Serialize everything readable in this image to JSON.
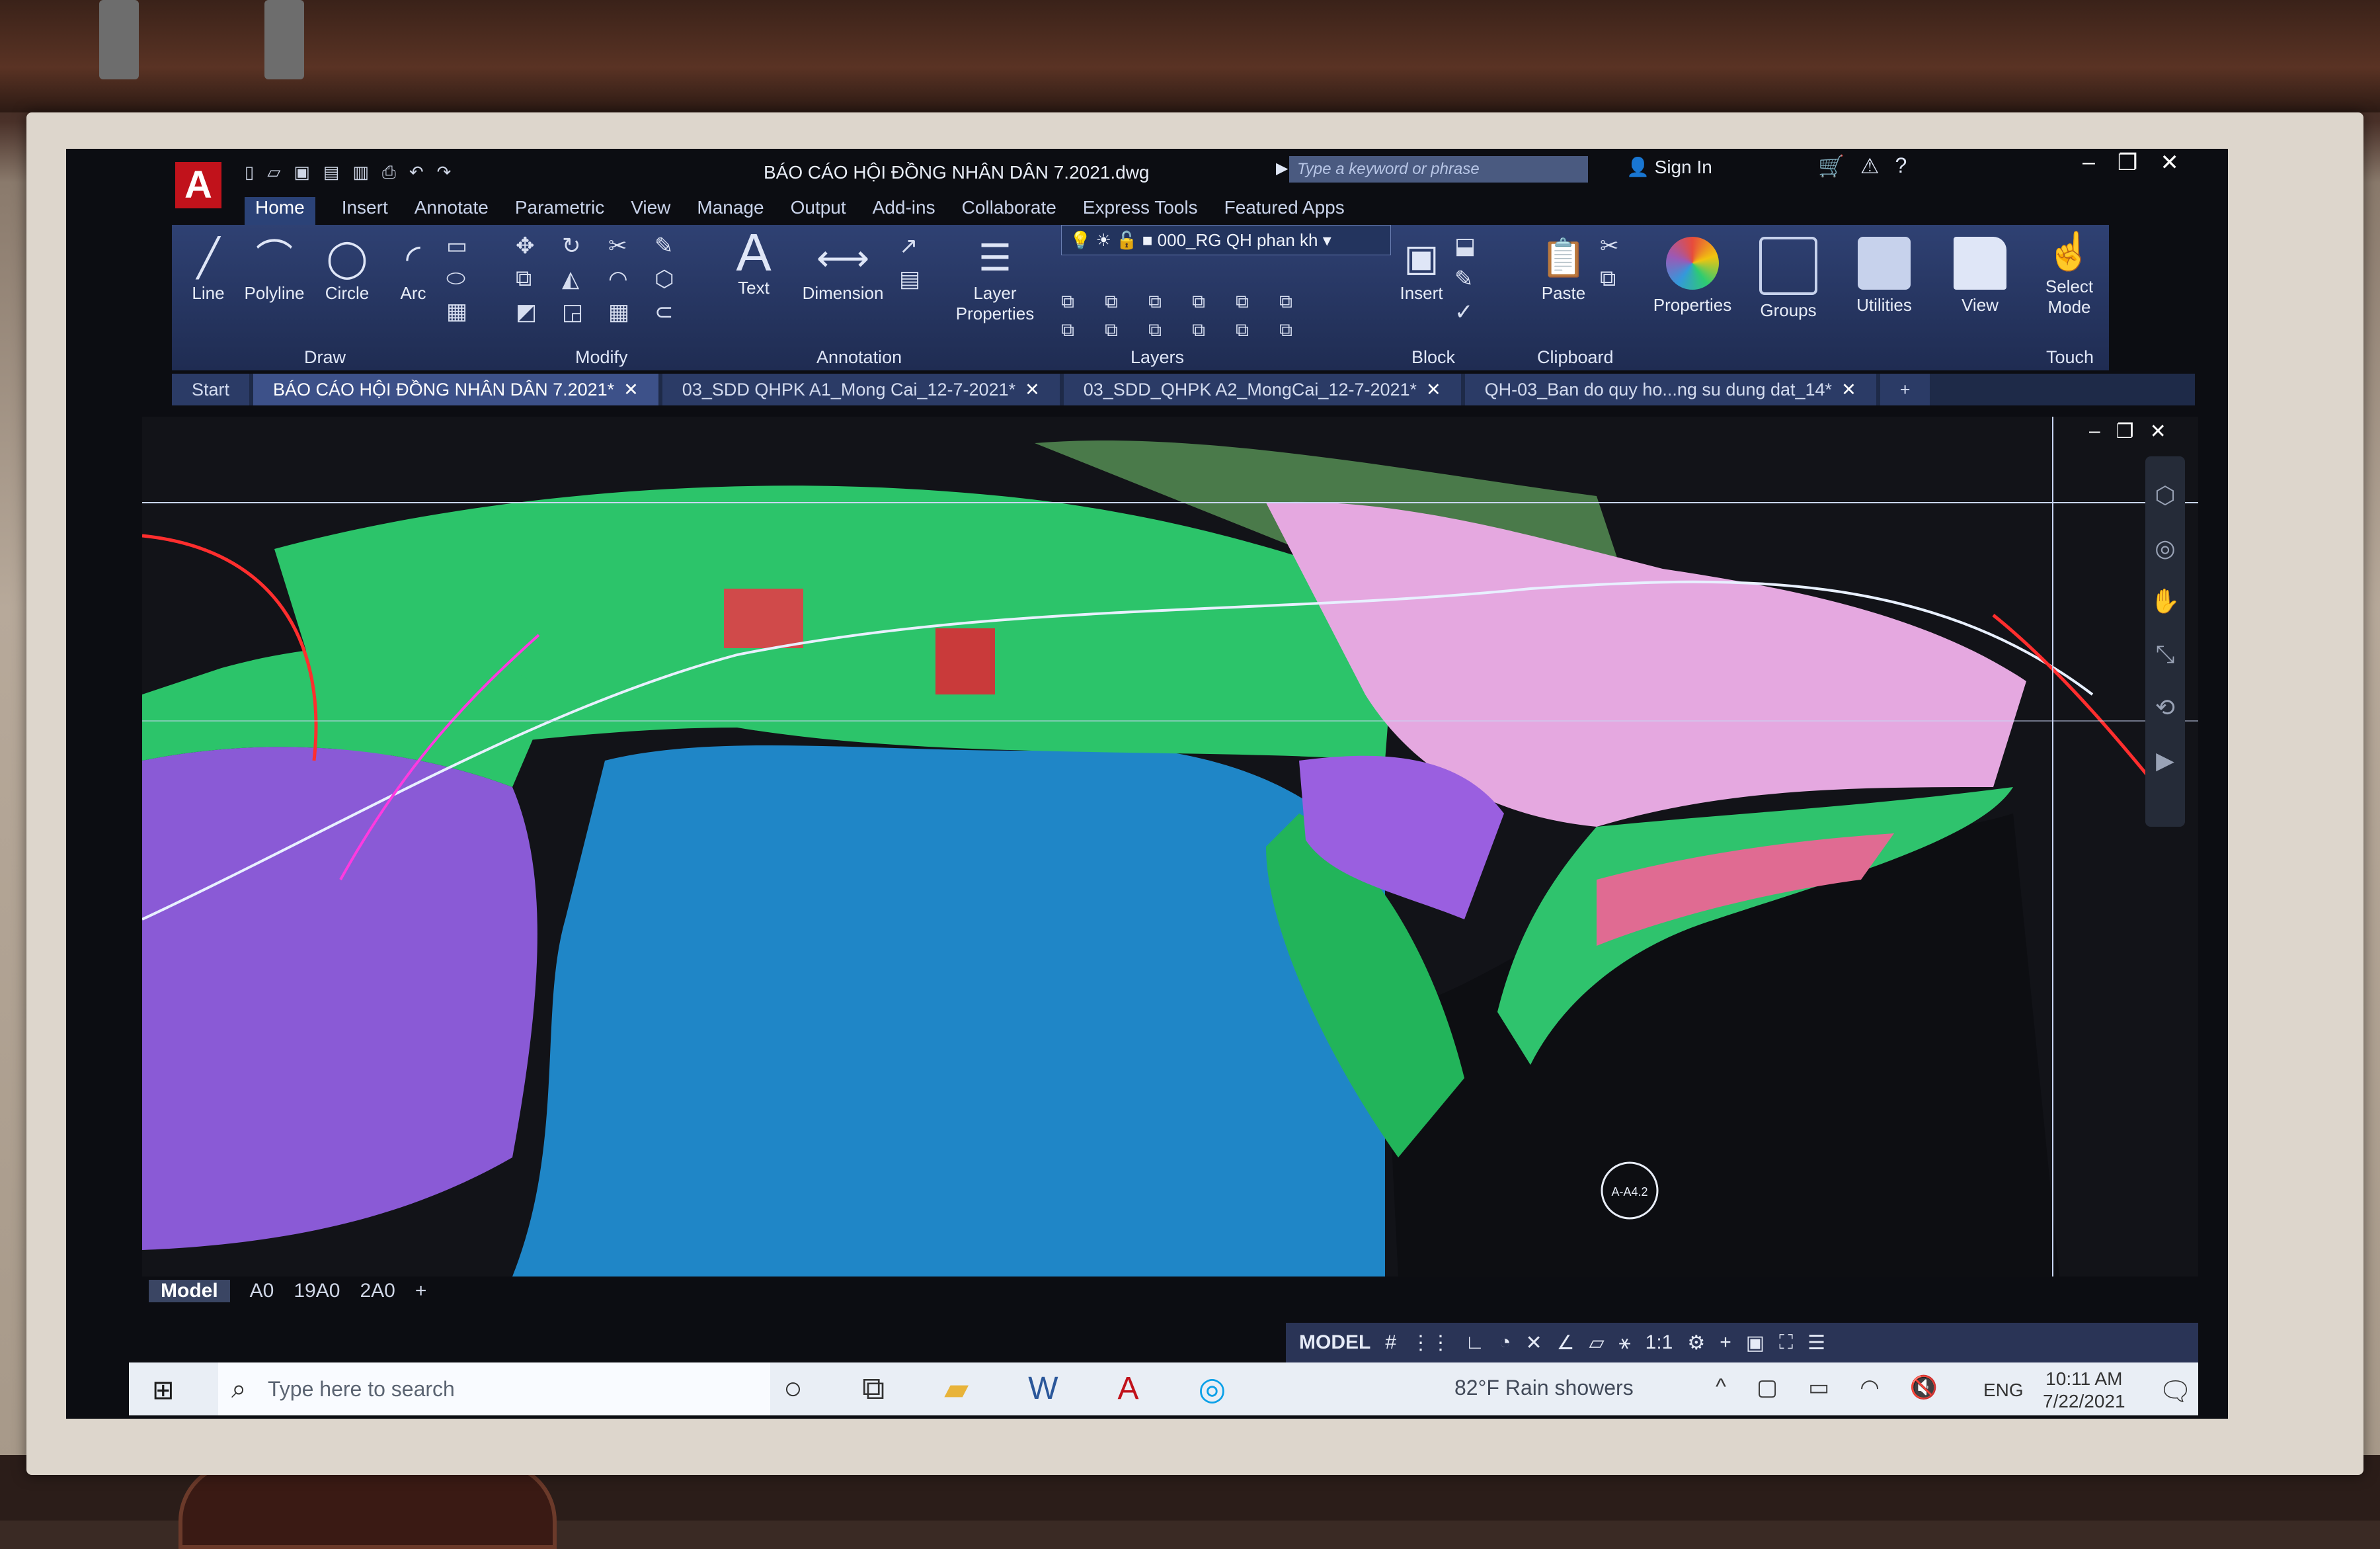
{
  "app": {
    "logo": "A",
    "document_title": "BÁO CÁO HỘI ĐỒNG NHÂN DÂN 7.2021.dwg",
    "search_placeholder": "Type a keyword or phrase",
    "sign_in": "Sign In"
  },
  "ribbon_tabs": [
    "Home",
    "Insert",
    "Annotate",
    "Parametric",
    "View",
    "Manage",
    "Output",
    "Add-ins",
    "Collaborate",
    "Express Tools",
    "Featured Apps"
  ],
  "ribbon": {
    "draw": {
      "line": "Line",
      "polyline": "Polyline",
      "circle": "Circle",
      "arc": "Arc",
      "panel": "Draw"
    },
    "modify": {
      "panel": "Modify"
    },
    "annotation": {
      "text": "Text",
      "dimension": "Dimension",
      "panel": "Annotation"
    },
    "layers": {
      "layer_properties": "Layer\nProperties",
      "current_layer": "000_RG QH phan kh",
      "panel": "Layers"
    },
    "block": {
      "insert": "Insert",
      "panel": "Block"
    },
    "clipboard": {
      "paste": "Paste",
      "panel": "Clipboard"
    },
    "properties": "Properties",
    "groups": "Groups",
    "utilities": "Utilities",
    "view": "View",
    "select_mode": "Select\nMode",
    "touch": "Touch"
  },
  "file_tabs": [
    {
      "label": "Start",
      "active": false,
      "closable": false
    },
    {
      "label": "BÁO CÁO HỘI ĐỒNG NHÂN DÂN 7.2021*",
      "active": true,
      "closable": true
    },
    {
      "label": "03_SDD QHPK A1_Mong Cai_12-7-2021*",
      "active": false,
      "closable": true
    },
    {
      "label": "03_SDD_QHPK A2_MongCai_12-7-2021*",
      "active": false,
      "closable": true
    },
    {
      "label": "QH-03_Ban do quy ho...ng su dung dat_14*",
      "active": false,
      "closable": true
    }
  ],
  "drawing": {
    "marker_label": "A-A4.2"
  },
  "layout_tabs": [
    {
      "label": "Model",
      "active": true
    },
    {
      "label": "A0",
      "active": false
    },
    {
      "label": "19A0",
      "active": false
    },
    {
      "label": "2A0",
      "active": false
    }
  ],
  "statusbar": {
    "model": "MODEL",
    "scale": "1:1"
  },
  "taskbar": {
    "search_placeholder": "Type here to search",
    "weather": "82°F  Rain showers",
    "language": "ENG",
    "time": "10:11 AM",
    "date": "7/22/2021"
  },
  "colors": {
    "ribbon": "#2f4173",
    "accent": "#c1121b",
    "water": "#1e6fb0",
    "green": "#22b45a",
    "pink": "#e7a6e8",
    "purple": "#8a5ad6"
  }
}
